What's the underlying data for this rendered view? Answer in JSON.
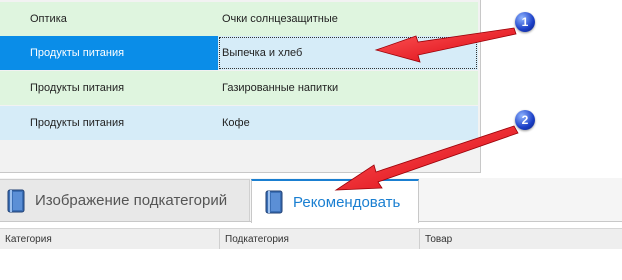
{
  "grid": {
    "rows": [
      {
        "category": "Оптика",
        "subcategory": "Очки солнцезащитные",
        "style": "green",
        "selected": false
      },
      {
        "category": "Продукты питания",
        "subcategory": "Выпечка и хлеб",
        "style": "blue",
        "selected": true
      },
      {
        "category": "Продукты питания",
        "subcategory": "Газированные напитки",
        "style": "green",
        "selected": false
      },
      {
        "category": "Продукты питания",
        "subcategory": "Кофе",
        "style": "blue",
        "selected": false
      }
    ]
  },
  "tabs": [
    {
      "label": "Изображение подкатегорий",
      "active": false,
      "icon": "book-icon"
    },
    {
      "label": "Рекомендовать",
      "active": true,
      "icon": "book-icon"
    }
  ],
  "table": {
    "columns": [
      "Категория",
      "Подкатегория",
      "Товар"
    ]
  },
  "annotations": {
    "badge1": "1",
    "badge2": "2",
    "arrow_color": "#e8101a"
  },
  "colors": {
    "selected_cell": "#0a8de8",
    "row_green": "#dff5df",
    "row_blue": "#d6ecf8",
    "active_tab_text": "#1a7fd1"
  }
}
